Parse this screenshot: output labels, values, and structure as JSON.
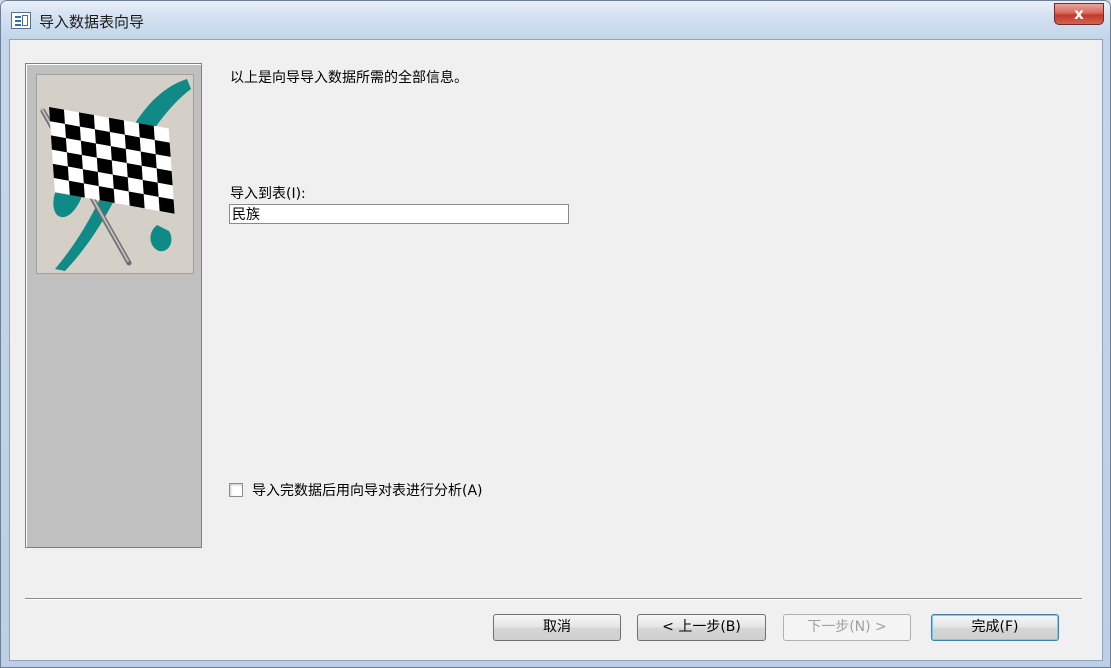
{
  "window": {
    "title": "导入数据表向导",
    "close_label": "x"
  },
  "wizard": {
    "info_text": "以上是向导导入数据所需的全部信息。",
    "import_to_label": "导入到表(I):",
    "import_to_value": "民族",
    "analyze_checkbox_label": "导入完数据后用向导对表进行分析(A)",
    "analyze_checked": false
  },
  "buttons": {
    "cancel": "取消",
    "back": "< 上一步(B)",
    "next": "下一步(N) >",
    "finish": "完成(F)"
  },
  "colors": {
    "flag_accent": "#0f8a86",
    "client_bg": "#f0f0f0",
    "side_panel_bg": "#c0c0c0"
  }
}
